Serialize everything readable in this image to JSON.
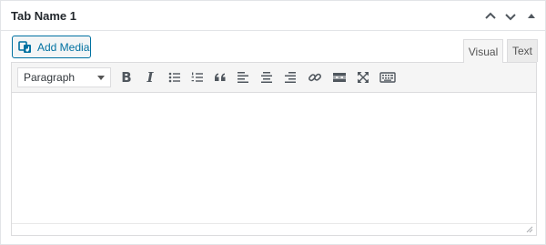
{
  "panel": {
    "title": "Tab Name 1"
  },
  "handle_buttons": {
    "up": "chevron-up-icon",
    "down": "chevron-down-icon",
    "toggle": "triangle-up-icon"
  },
  "media": {
    "add_label": "Add Media",
    "icon": "add-media-icon"
  },
  "editor_tabs": {
    "visual": "Visual",
    "text": "Text",
    "active": "Visual"
  },
  "toolbar": {
    "format_value": "Paragraph",
    "bold_label": "B",
    "italic_label": "I",
    "icons": [
      "bold-icon",
      "italic-icon",
      "bullet-list-icon",
      "numbered-list-icon",
      "blockquote-icon",
      "align-left-icon",
      "align-center-icon",
      "align-right-icon",
      "link-icon",
      "read-more-icon",
      "fullscreen-icon",
      "toolbar-toggle-icon"
    ]
  },
  "colors": {
    "accent": "#0071a1",
    "toolbar_bg": "#f5f5f5",
    "border": "#dcdcde",
    "icon": "#50575e"
  }
}
